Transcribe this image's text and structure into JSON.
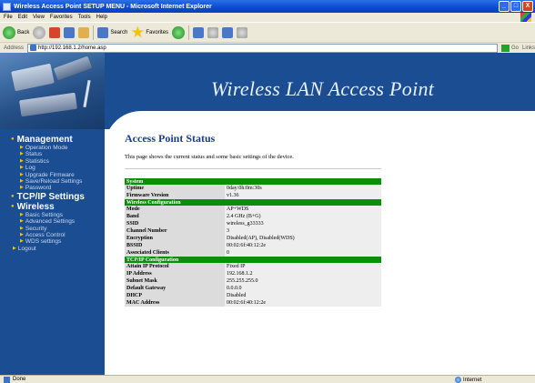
{
  "window": {
    "title": "Wireless Access Point SETUP MENU - Microsoft Internet Explorer",
    "controls": [
      "_",
      "□",
      "X"
    ]
  },
  "menubar": [
    "File",
    "Edit",
    "View",
    "Favorites",
    "Tools",
    "Help"
  ],
  "toolbar": {
    "back_label": "Back",
    "search_label": "Search",
    "favorites_label": "Favorites"
  },
  "addressbar": {
    "label": "Address",
    "url": "http://192.168.1.2/home.asp",
    "go_label": "Go",
    "links_label": "Links"
  },
  "banner": {
    "title": "Wireless LAN Access Point"
  },
  "sidebar": {
    "sections": [
      {
        "title": "Management",
        "items": [
          "Operation Mode",
          "Status",
          "Statistics",
          "Log",
          "Upgrade Firmware",
          "Save/Reload Settings",
          "Password"
        ]
      },
      {
        "title": "TCP/IP Settings",
        "items": []
      },
      {
        "title": "Wireless",
        "items": [
          "Basic Settings",
          "Advanced Settings",
          "Security",
          "Access Control",
          "WDS settings"
        ]
      }
    ],
    "logout": "Logout"
  },
  "main": {
    "title": "Access Point Status",
    "description": "This page shows the current status and some basic settings of the device.",
    "sections": [
      {
        "header": "System",
        "rows": [
          {
            "label": "Uptime",
            "value": "0day:0h:0m:30s"
          },
          {
            "label": "Firmware Version",
            "value": "v1.36"
          }
        ]
      },
      {
        "header": "Wireless Configuration",
        "rows": [
          {
            "label": "Mode",
            "value": "AP+WDS"
          },
          {
            "label": "Band",
            "value": "2.4 GHz (B+G)"
          },
          {
            "label": "SSID",
            "value": "wireless_g33333"
          },
          {
            "label": "Channel Number",
            "value": "3"
          },
          {
            "label": "Encryption",
            "value": "Disabled(AP), Disabled(WDS)"
          },
          {
            "label": "BSSID",
            "value": "00:02:6f:40:12:2e"
          },
          {
            "label": "Associated Clients",
            "value": "0"
          }
        ]
      },
      {
        "header": "TCP/IP Configuration",
        "rows": [
          {
            "label": "Attain IP Protocol",
            "value": "Fixed IP"
          },
          {
            "label": "IP Address",
            "value": "192.168.1.2"
          },
          {
            "label": "Subnet Mask",
            "value": "255.255.255.0"
          },
          {
            "label": "Default Gateway",
            "value": "0.0.0.0"
          },
          {
            "label": "DHCP",
            "value": "Disabled"
          },
          {
            "label": "MAC Address",
            "value": "00:02:6f:40:12:2e"
          }
        ]
      }
    ]
  },
  "statusbar": {
    "left": "Done",
    "zone": "Internet"
  }
}
